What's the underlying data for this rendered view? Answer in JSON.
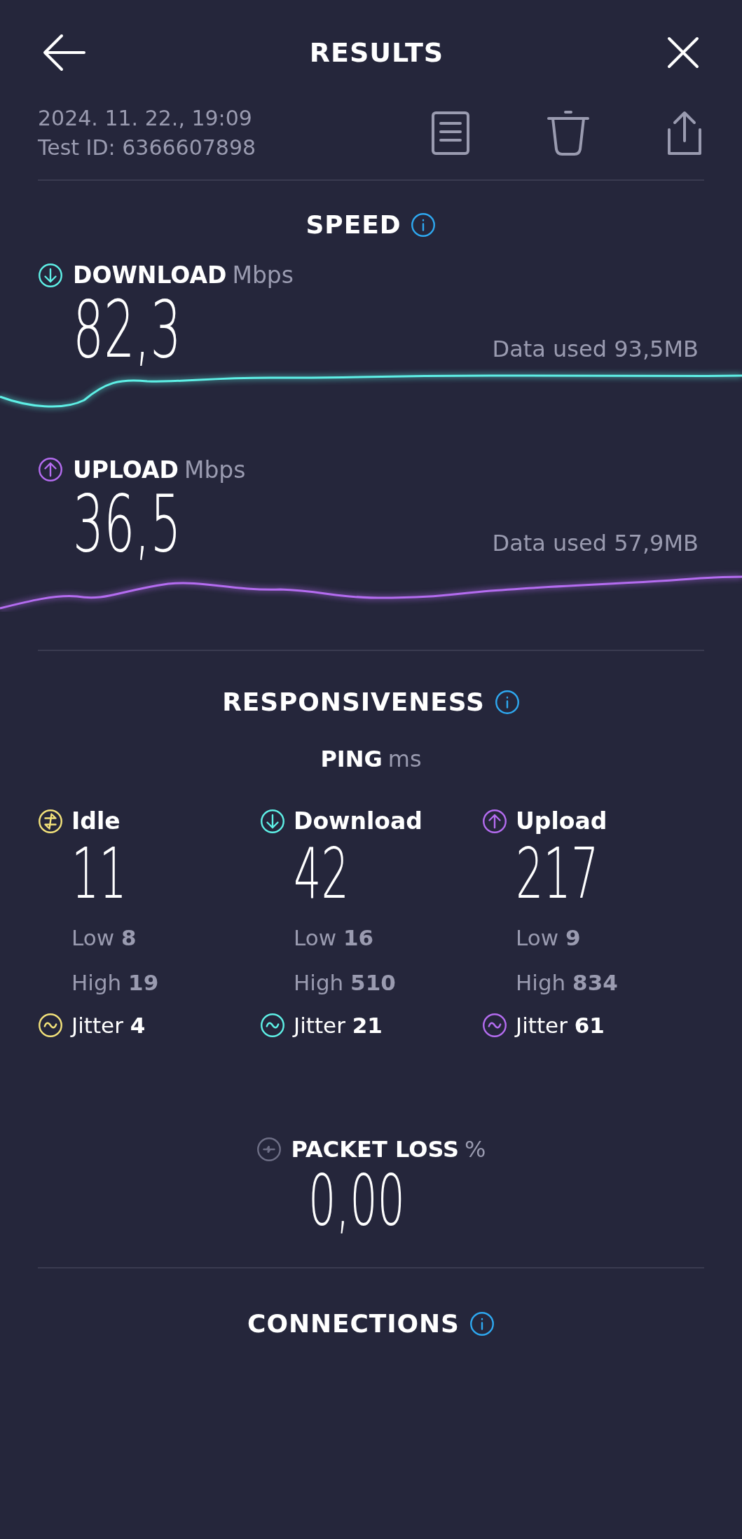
{
  "header": {
    "title": "RESULTS"
  },
  "meta": {
    "date": "2024. 11. 22., 19:09",
    "test_id": "Test ID: 6366607898"
  },
  "speed": {
    "title": "SPEED",
    "metrics": [
      {
        "kind": "download",
        "label": "DOWNLOAD",
        "unit": "Mbps",
        "value": "82,3",
        "data_used": "Data used 93,5MB"
      },
      {
        "kind": "upload",
        "label": "UPLOAD",
        "unit": "Mbps",
        "value": "36,5",
        "data_used": "Data used 57,9MB"
      }
    ]
  },
  "responsiveness": {
    "title": "RESPONSIVENESS",
    "ping_label": "PING",
    "ping_unit": "ms",
    "columns": [
      {
        "kind": "idle",
        "label": "Idle",
        "value": "11",
        "low": "Low **8**",
        "high": "High **19**",
        "jitter": "Jitter **4**"
      },
      {
        "kind": "download",
        "label": "Download",
        "value": "42",
        "low": "Low **16**",
        "high": "High **510**",
        "jitter": "Jitter **21**"
      },
      {
        "kind": "upload",
        "label": "Upload",
        "value": "217",
        "low": "Low **9**",
        "high": "High **834**",
        "jitter": "Jitter **61**"
      }
    ]
  },
  "packet_loss": {
    "label": "PACKET LOSS",
    "unit": "%",
    "value": "0,00"
  },
  "connections": {
    "title": "CONNECTIONS"
  }
}
